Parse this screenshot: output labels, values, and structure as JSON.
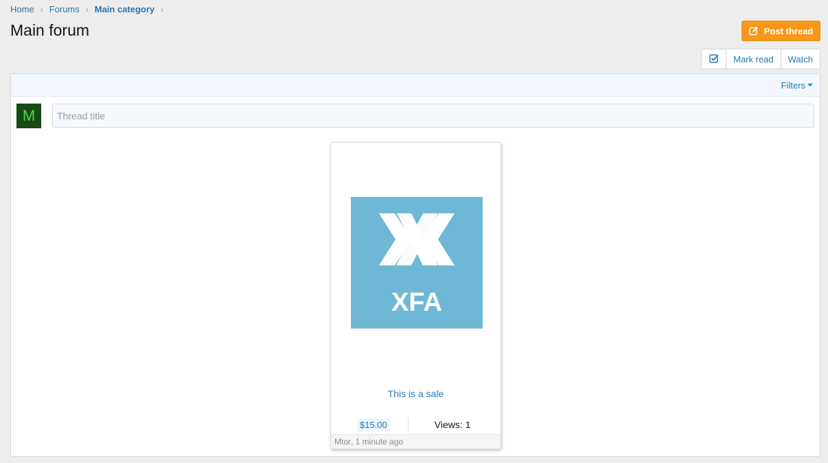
{
  "breadcrumb": [
    {
      "label": "Home"
    },
    {
      "label": "Forums"
    },
    {
      "label": "Main category"
    }
  ],
  "page": {
    "title": "Main forum"
  },
  "post_thread_button": {
    "label": "Post thread",
    "icon": "edit-icon",
    "color": "#f7981c"
  },
  "actions": {
    "select_icon": "checkbox-icon",
    "mark_read": "Mark read",
    "watch": "Watch"
  },
  "filters": {
    "label": "Filters"
  },
  "quick_thread": {
    "avatar_letter": "M",
    "avatar_bg": "#174a15",
    "avatar_fg": "#4ed448",
    "title_placeholder": "Thread title"
  },
  "thread": {
    "thumbnail": {
      "logo_text": "XFA",
      "bg_color": "#6eb8d5"
    },
    "title": "This is a sale",
    "price": "$15.00",
    "views_label": "Views:",
    "views_count": "1",
    "author": "Mtor",
    "separator": ", ",
    "time_ago": "1 minute ago"
  },
  "colors": {
    "link": "#2577b1",
    "background": "#ededed"
  }
}
